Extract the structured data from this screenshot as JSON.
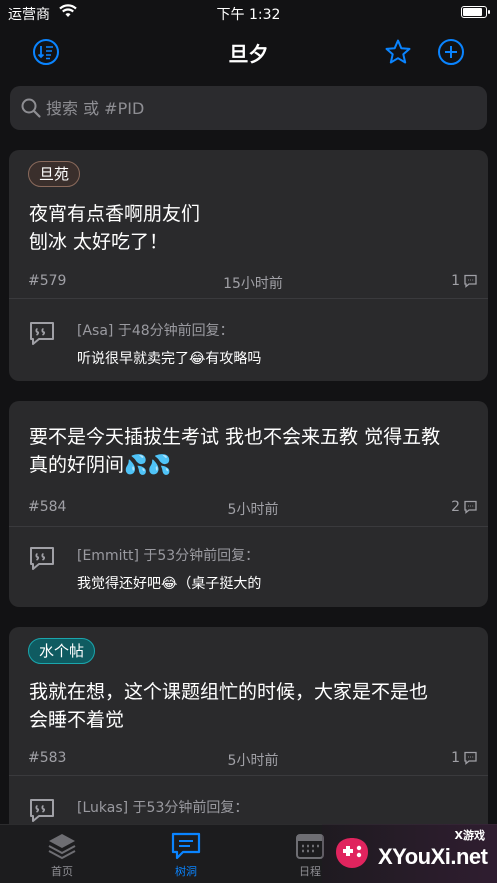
{
  "status": {
    "carrier": "运营商",
    "time": "下午 1:32",
    "battery_level": 0.9
  },
  "nav": {
    "title": "旦夕"
  },
  "search": {
    "placeholder": "搜索 或 #PID"
  },
  "posts": [
    {
      "tag": "旦苑",
      "text_lines": [
        "夜宵有点香啊朋友们",
        "刨冰 太好吃了！"
      ],
      "pid": "#579",
      "time": "15小时前",
      "reply_count": "1",
      "reply_head": "[Asa] 于48分钟前回复：",
      "reply_body": "听说很早就卖完了😂有攻略吗"
    },
    {
      "tag": "",
      "text_lines": [
        "要不是今天插拔生考试 我也不会来五教 觉得五教",
        "真的好阴间💦💦"
      ],
      "pid": "#584",
      "time": "5小时前",
      "reply_count": "2",
      "reply_head": "[Emmitt] 于53分钟前回复：",
      "reply_body": "我觉得还好吧😂（桌子挺大的"
    },
    {
      "tag": "水个帖",
      "text_lines": [
        "我就在想，这个课题组忙的时候，大家是不是也",
        "会睡不着觉"
      ],
      "pid": "#583",
      "time": "5小时前",
      "reply_count": "1",
      "reply_head": "[Lukas] 于53分钟前回复：",
      "reply_body": ""
    }
  ],
  "tabs": [
    {
      "label": "首页",
      "icon": "stack-icon"
    },
    {
      "label": "树洞",
      "icon": "chat-icon"
    },
    {
      "label": "日程",
      "icon": "calendar-icon"
    }
  ],
  "watermark": {
    "top": "X游戏",
    "text": "XYouXi.net"
  },
  "colors": {
    "accent": "#0a84ff",
    "background": "#121214",
    "card": "#2a2a2c"
  }
}
